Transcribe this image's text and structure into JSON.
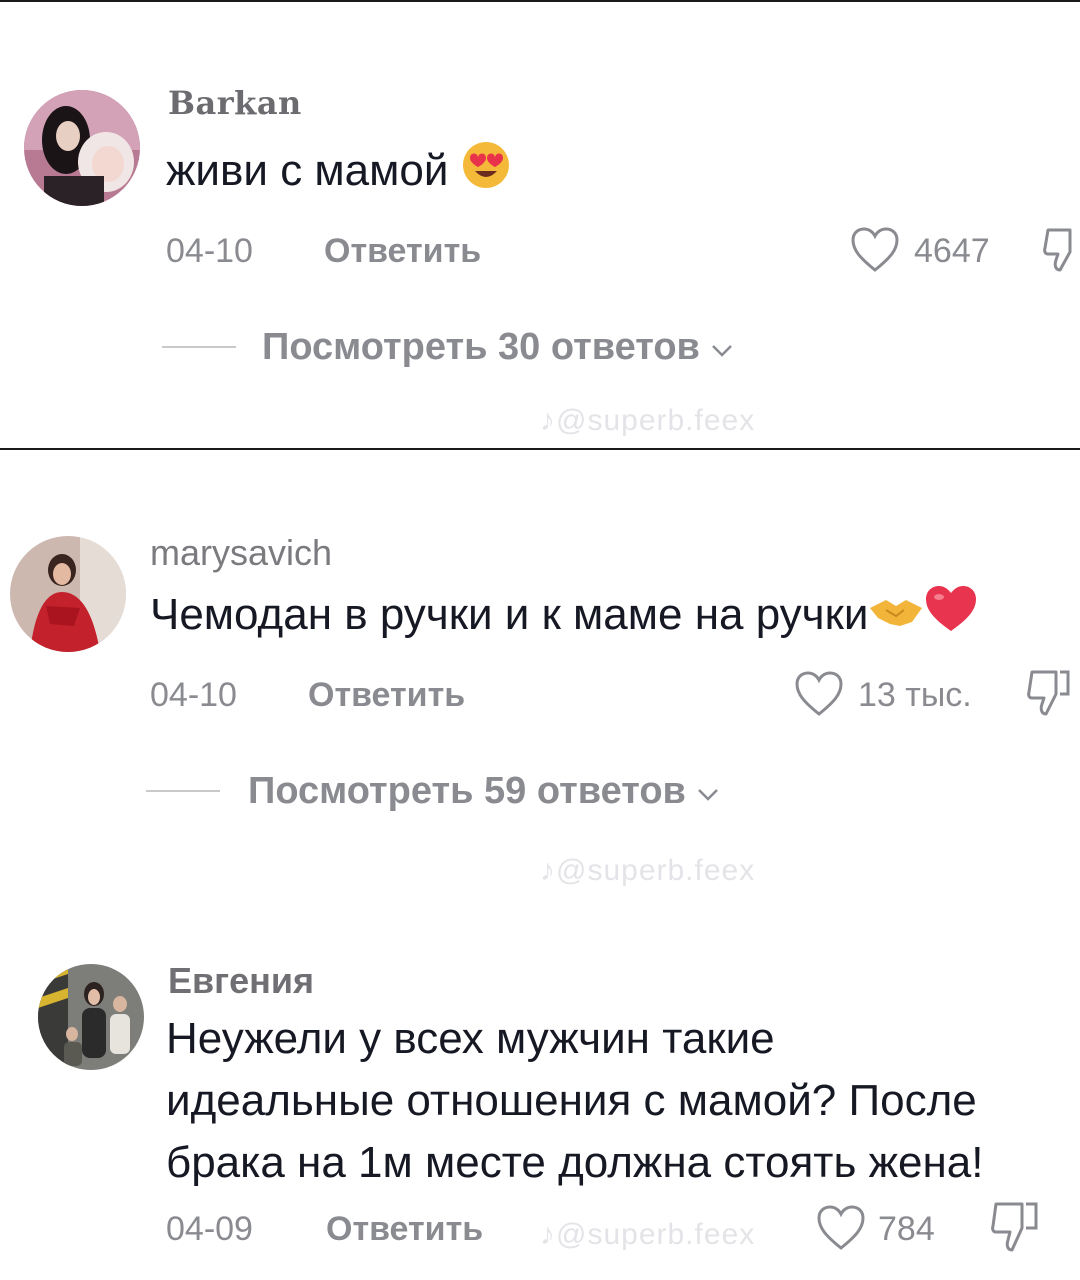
{
  "watermark": "@superb.feex",
  "comments": [
    {
      "username": "Barkan",
      "text": "живи с мамой",
      "date": "04-10",
      "reply_label": "Ответить",
      "likes": "4647",
      "view_replies": "Посмотреть 30 ответов",
      "emoji": "heart-eyes-emoji"
    },
    {
      "username": "marysavich",
      "text": "Чемодан в ручки и к маме на ручки",
      "date": "04-10",
      "reply_label": "Ответить",
      "likes": "13 тыс.",
      "view_replies": "Посмотреть 59 ответов",
      "emoji": "handshake-heart-emoji"
    },
    {
      "username": "Евгения",
      "text_lines": [
        "Неужели у всех мужчин такие",
        "идеальные отношения с мамой? После",
        "брака на 1м месте должна стоять жена!"
      ],
      "date": "04-09",
      "reply_label": "Ответить",
      "likes": "784"
    }
  ],
  "colors": {
    "text": "#161823",
    "meta": "#8a8b91",
    "divider": "#1a1a1a"
  }
}
